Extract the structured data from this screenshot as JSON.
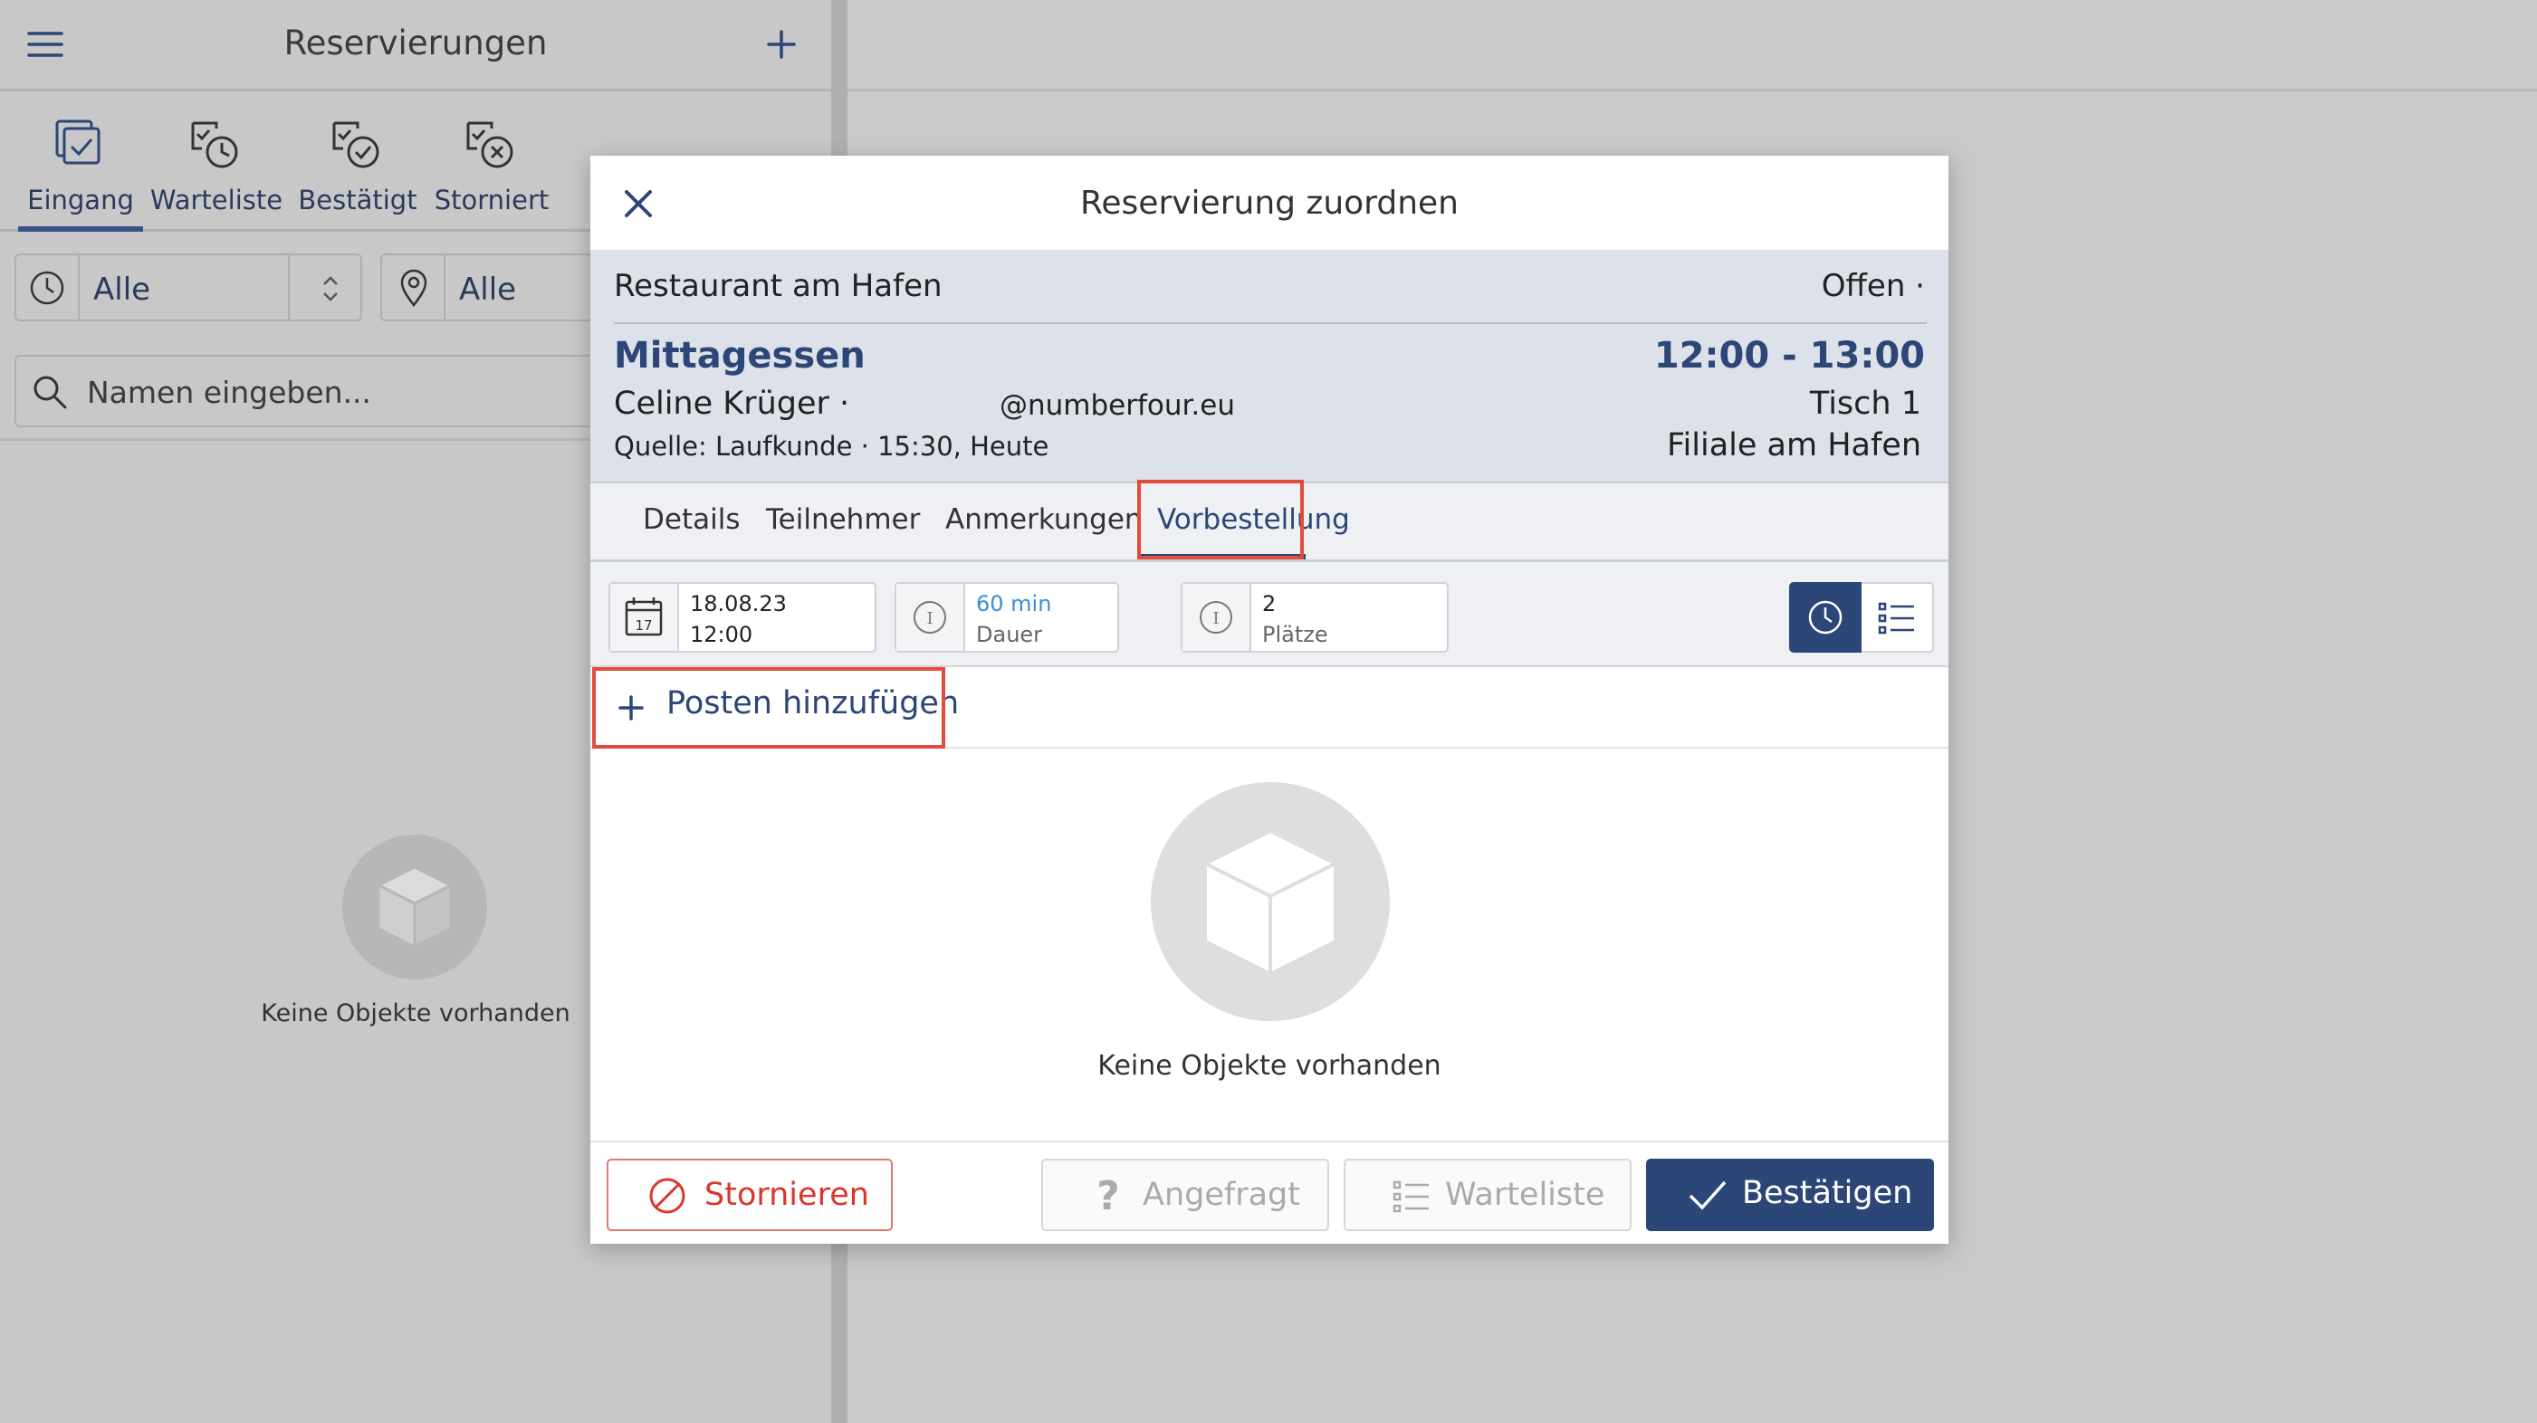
{
  "app": {
    "title": "Reservierungen",
    "tabs": [
      {
        "label": "Eingang",
        "icon": "inbox-icon"
      },
      {
        "label": "Warteliste",
        "icon": "waitlist-clock-icon"
      },
      {
        "label": "Bestätigt",
        "icon": "confirmed-check-icon"
      },
      {
        "label": "Storniert",
        "icon": "cancelled-x-icon"
      }
    ],
    "filters": {
      "time": "Alle",
      "location": "Alle"
    },
    "search": {
      "placeholder": "Namen eingeben..."
    },
    "empty": "Keine Objekte vorhanden"
  },
  "modal": {
    "title": "Reservierung zuordnen",
    "restaurant": "Restaurant am Hafen",
    "state": "Offen ·",
    "meal": "Mittagessen",
    "time": "12:00 - 13:00",
    "guest": "Celine Krüger ·",
    "email": "@numberfour.eu",
    "table": "Tisch 1",
    "source": "Quelle: Laufkunde · 15:30, Heute",
    "branch": "Filiale am Hafen",
    "tabs": [
      "Details",
      "Teilnehmer",
      "Anmerkungen",
      "Vorbestellung"
    ],
    "fields": {
      "date": "18.08.23",
      "time": "12:00",
      "duration_value": "60 min",
      "duration_label": "Dauer",
      "seats_value": "2",
      "seats_label": "Plätze",
      "calendar_day": "17"
    },
    "add_item": "Posten hinzufügen",
    "empty": "Keine Objekte vorhanden",
    "buttons": {
      "cancel": "Stornieren",
      "requested": "Angefragt",
      "waitlist": "Warteliste",
      "confirm": "Bestätigen"
    },
    "colors": {
      "accent": "#2c4677",
      "danger": "#d9372a",
      "highlight": "#e34b3b",
      "duration": "#3a8fd6"
    }
  }
}
